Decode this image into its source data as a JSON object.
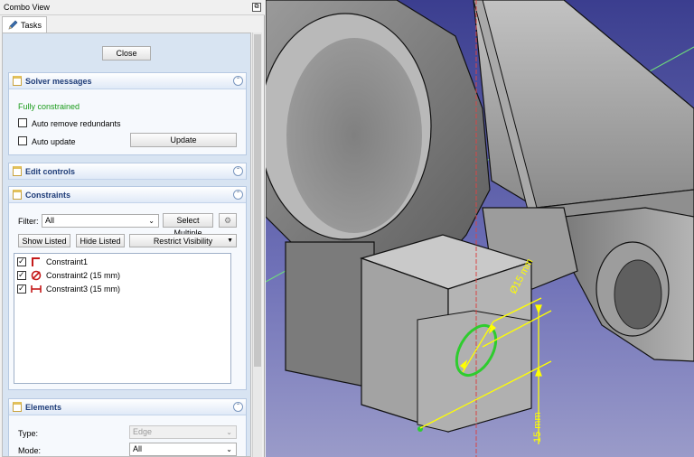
{
  "combo": {
    "title": "Combo View",
    "tab_label": "Tasks",
    "close_label": "Close"
  },
  "solver": {
    "title": "Solver messages",
    "status": "Fully constrained",
    "status_color": "#1a9b1a",
    "auto_remove_label": "Auto remove redundants",
    "auto_remove_checked": false,
    "auto_update_label": "Auto update",
    "auto_update_checked": false,
    "update_label": "Update"
  },
  "edit_controls": {
    "title": "Edit controls"
  },
  "constraints": {
    "title": "Constraints",
    "filter_label": "Filter:",
    "filter_value": "All",
    "select_multiple_label": "Select Multiple",
    "show_listed_label": "Show Listed",
    "hide_listed_label": "Hide Listed",
    "restrict_visibility_label": "Restrict Visibility",
    "items": [
      {
        "label": "Constraint1",
        "icon": "angle-constraint-icon",
        "checked": true
      },
      {
        "label": "Constraint2 (15 mm)",
        "icon": "diameter-constraint-icon",
        "checked": true
      },
      {
        "label": "Constraint3 (15 mm)",
        "icon": "distance-constraint-icon",
        "checked": true
      }
    ]
  },
  "elements": {
    "title": "Elements",
    "type_label": "Type:",
    "type_value": "Edge",
    "mode_label": "Mode:",
    "mode_value": "All"
  },
  "viewport": {
    "diameter_dim": "Ø15 mm",
    "distance_dim": "15 mm",
    "background_top": "#3b3e8f",
    "background_bottom": "#9a9bc9",
    "dimension_color": "#ffff00",
    "circle_color": "#2ecc2e"
  }
}
